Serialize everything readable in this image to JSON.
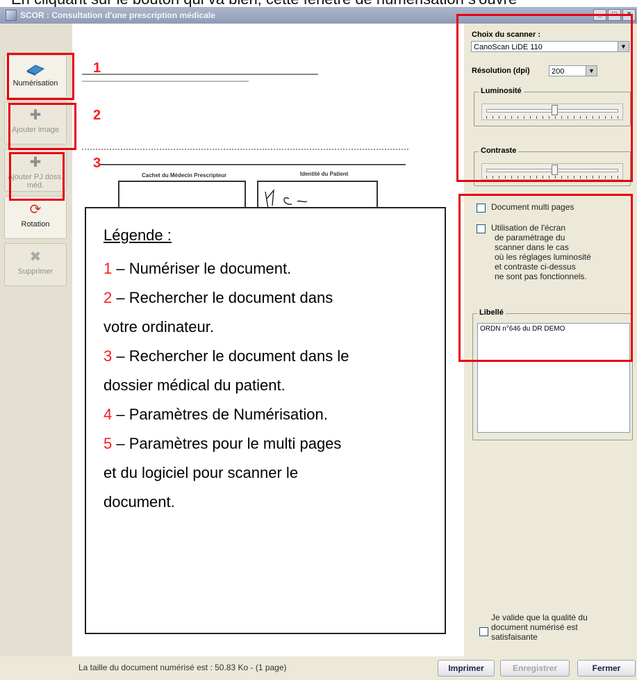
{
  "caption": "En cliquant sur le bouton qui va bien, cette fenêtre de numérisation s'ouvre",
  "window": {
    "title": "SCOR : Consultation d'une prescription médicale",
    "min_icon": "minimize-icon",
    "max_icon": "maximize-icon",
    "close_icon": "close-icon"
  },
  "toolbar": {
    "items": [
      {
        "label": "Numérisation",
        "icon": "scanner-icon",
        "enabled": true
      },
      {
        "label": "Ajouter image",
        "icon": "add-image-icon",
        "enabled": false
      },
      {
        "label": "Ajouter PJ doss. méd.",
        "icon": "add-attachment-icon",
        "enabled": false
      },
      {
        "label": "Rotation",
        "icon": "rotate-icon",
        "enabled": true
      },
      {
        "label": "Supprimer",
        "icon": "delete-icon",
        "enabled": false
      }
    ]
  },
  "document": {
    "cachet_label": "Cachet du Médecin Prescripteur",
    "patient_label": "Identité du Patient"
  },
  "legend": {
    "title": "Légende :",
    "items": [
      {
        "num": "1",
        "text": " – Numériser le document."
      },
      {
        "num": "2",
        "text": " – Rechercher le document dans"
      },
      {
        "num": "",
        "text": "votre ordinateur."
      },
      {
        "num": "3",
        "text": " – Rechercher le document dans le"
      },
      {
        "num": "",
        "text": "dossier médical du patient."
      },
      {
        "num": "4",
        "text": " – Paramètres de Numérisation."
      },
      {
        "num": "5",
        "text": " – Paramètres pour le multi pages"
      },
      {
        "num": "",
        "text": "et du logiciel pour scanner le"
      },
      {
        "num": "",
        "text": "document."
      }
    ]
  },
  "annotations": [
    "1",
    "2",
    "3"
  ],
  "settings": {
    "scanner_label": "Choix du scanner :",
    "scanner_value": "CanoScan LiDE 110",
    "resolution_label": "Résolution (dpi)",
    "resolution_value": "200",
    "luminosite_label": "Luminosité",
    "luminosite_level": 0.52,
    "contraste_label": "Contraste",
    "contraste_level": 0.52,
    "multi_pages_label": "Document multi pages",
    "multi_pages_checked": false,
    "ecran_label_lines": [
      "Utilisation de l'écran",
      "de paramétrage du",
      "scanner dans le cas",
      "où les réglages luminosité",
      "et contraste ci-dessus",
      "ne sont pas fonctionnels."
    ],
    "ecran_checked": false,
    "libelle_label": "Libellé",
    "libelle_value": "ORDN n°646 du DR DEMO",
    "quality_lines": [
      "Je valide que la qualité du",
      "document numérisé est",
      "satisfaisante"
    ],
    "quality_checked": false
  },
  "status": {
    "text": "La taille du document numérisé est : 50.83 Ko  -  (1 page)",
    "print_label": "Imprimer",
    "save_label": "Enregistrer",
    "close_label": "Fermer"
  }
}
